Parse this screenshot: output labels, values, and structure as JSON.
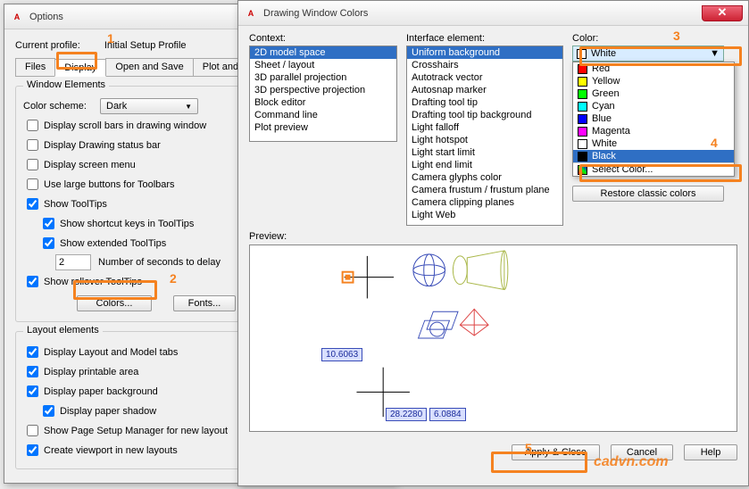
{
  "options": {
    "title": "Options",
    "profile_label": "Current profile:",
    "profile_value": "Initial Setup Profile",
    "tabs": [
      "Files",
      "Display",
      "Open and Save",
      "Plot and Publ"
    ],
    "window_elements": {
      "group": "Window Elements",
      "color_scheme_label": "Color scheme:",
      "color_scheme_value": "Dark",
      "scrollbars": "Display scroll bars in drawing window",
      "statusbar": "Display Drawing status bar",
      "screenmenu": "Display screen menu",
      "large_buttons": "Use large buttons for Toolbars",
      "tooltips": "Show ToolTips",
      "shortcut_keys": "Show shortcut keys in ToolTips",
      "extended": "Show extended ToolTips",
      "seconds_val": "2",
      "seconds_lbl": "Number of seconds to delay",
      "rollover": "Show rollover ToolTips",
      "colors_btn": "Colors...",
      "fonts_btn": "Fonts..."
    },
    "layout_elements": {
      "group": "Layout elements",
      "tabs": "Display Layout and Model tabs",
      "printable": "Display printable area",
      "paper_bg": "Display paper background",
      "shadow": "Display paper shadow",
      "page_setup": "Show Page Setup Manager for new layout",
      "viewport": "Create viewport in new layouts"
    }
  },
  "dwc": {
    "title": "Drawing Window Colors",
    "context_label": "Context:",
    "context_items": [
      "2D model space",
      "Sheet / layout",
      "3D parallel projection",
      "3D perspective projection",
      "Block editor",
      "Command line",
      "Plot preview"
    ],
    "interface_label": "Interface element:",
    "interface_items": [
      "Uniform background",
      "Crosshairs",
      "Autotrack vector",
      "Autosnap marker",
      "Drafting tool tip",
      "Drafting tool tip background",
      "Light falloff",
      "Light hotspot",
      "Light start limit",
      "Light end limit",
      "Camera glyphs color",
      "Camera frustum / frustum plane",
      "Camera clipping planes",
      "Light Web"
    ],
    "color_label": "Color:",
    "color_selected": "White",
    "color_items": [
      {
        "name": "Red",
        "hex": "#ff0000"
      },
      {
        "name": "Yellow",
        "hex": "#ffff00"
      },
      {
        "name": "Green",
        "hex": "#00ff00"
      },
      {
        "name": "Cyan",
        "hex": "#00ffff"
      },
      {
        "name": "Blue",
        "hex": "#0000ff"
      },
      {
        "name": "Magenta",
        "hex": "#ff00ff"
      },
      {
        "name": "White",
        "hex": "#ffffff"
      },
      {
        "name": "Black",
        "hex": "#000000"
      }
    ],
    "select_color": "Select Color...",
    "restore_btn": "Restore classic colors",
    "preview_label": "Preview:",
    "dim1": "10.6063",
    "dim2": "28.2280",
    "dim3": "6.0884",
    "apply_btn": "Apply & Close",
    "cancel_btn": "Cancel",
    "help_btn": "Help"
  },
  "annot": {
    "n1": "1",
    "n2": "2",
    "n3": "3",
    "n4": "4",
    "n5": "5"
  },
  "watermark": "cadvn.com"
}
